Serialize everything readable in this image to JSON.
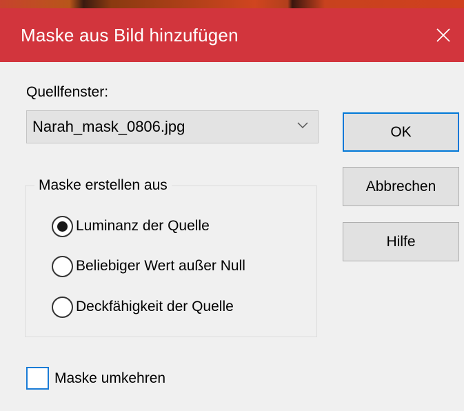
{
  "window": {
    "title": "Maske aus Bild hinzufügen",
    "close_icon": "close-icon"
  },
  "source": {
    "label": "Quellfenster:",
    "selected": "Narah_mask_0806.jpg"
  },
  "buttons": {
    "ok": "OK",
    "cancel": "Abbrechen",
    "help": "Hilfe"
  },
  "mask_group": {
    "legend": "Maske erstellen aus",
    "options": [
      {
        "label": "Luminanz der Quelle",
        "checked": true
      },
      {
        "label": "Beliebiger Wert außer Null",
        "checked": false
      },
      {
        "label": "Deckfähigkeit der Quelle",
        "checked": false
      }
    ]
  },
  "invert": {
    "label": "Maske umkehren",
    "checked": false
  },
  "colors": {
    "titlebar": "#d2353d",
    "focus_border": "#0078d7"
  }
}
